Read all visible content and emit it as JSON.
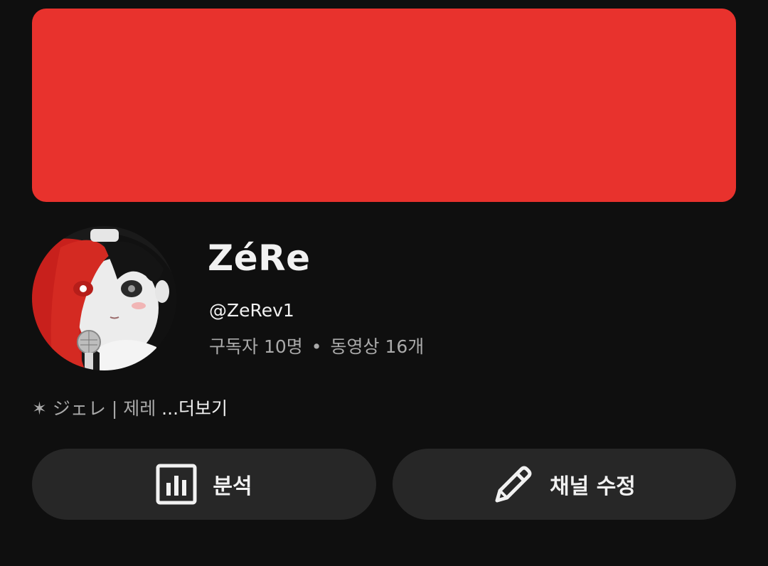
{
  "banner": {
    "color": "#e8322d"
  },
  "channel": {
    "name": "ZéRe",
    "handle": "@ZeRev1",
    "subscribers": "구독자 10명",
    "separator": "•",
    "videos": "동영상 16개"
  },
  "description": {
    "text": "✶ ジェレ | 제레 ",
    "more_label": "...더보기"
  },
  "actions": {
    "analytics": {
      "label": "분석",
      "icon": "analytics-icon"
    },
    "edit": {
      "label": "채널 수정",
      "icon": "pencil-icon"
    }
  },
  "colors": {
    "background": "#0f0f0f",
    "button_bg": "#272727",
    "text_primary": "#f1f1f1",
    "text_secondary": "#aaaaaa"
  }
}
